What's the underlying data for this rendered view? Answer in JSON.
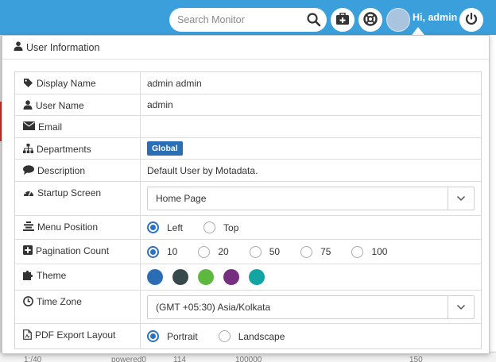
{
  "search": {
    "placeholder": "Search Monitor"
  },
  "header": {
    "greeting": "Hi, admin"
  },
  "icons": {
    "search": "search-icon",
    "medkit": "medkit-icon",
    "support": "lifebuoy-icon",
    "avatar": "user-avatar",
    "power": "power-icon"
  },
  "panel": {
    "title": "User Information"
  },
  "rows": {
    "display_name": {
      "label": "Display Name",
      "value": "admin admin"
    },
    "user_name": {
      "label": "User Name",
      "value": "admin"
    },
    "email": {
      "label": "Email",
      "value": ""
    },
    "departments": {
      "label": "Departments",
      "badge": "Global"
    },
    "description": {
      "label": "Description",
      "value": "Default User by Motadata."
    },
    "startup_screen": {
      "label": "Startup Screen",
      "selected": "Home Page"
    },
    "menu_position": {
      "label": "Menu Position",
      "options": [
        "Left",
        "Top"
      ],
      "selected": "Left"
    },
    "pagination_count": {
      "label": "Pagination Count",
      "options": [
        "10",
        "20",
        "50",
        "75",
        "100"
      ],
      "selected": "10"
    },
    "theme": {
      "label": "Theme",
      "colors": [
        "#2a6db4",
        "#38494c",
        "#5cb83e",
        "#74307e",
        "#12a5a3"
      ],
      "selected_index": 0
    },
    "time_zone": {
      "label": "Time Zone",
      "selected": "(GMT +05:30) Asia/Kolkata"
    },
    "pdf_export_layout": {
      "label": "PDF Export Layout",
      "options": [
        "Portrait",
        "Landscape"
      ],
      "selected": "Portrait"
    }
  },
  "background": {
    "fragment_1": "1:/40",
    "fragment_2": "powered0",
    "fragment_3": "114",
    "fragment_4": "100000",
    "fragment_5": "150"
  },
  "colors": {
    "topbar": "#3a9fdb",
    "accent": "#2a72c0",
    "badge": "#2a6fb5"
  }
}
